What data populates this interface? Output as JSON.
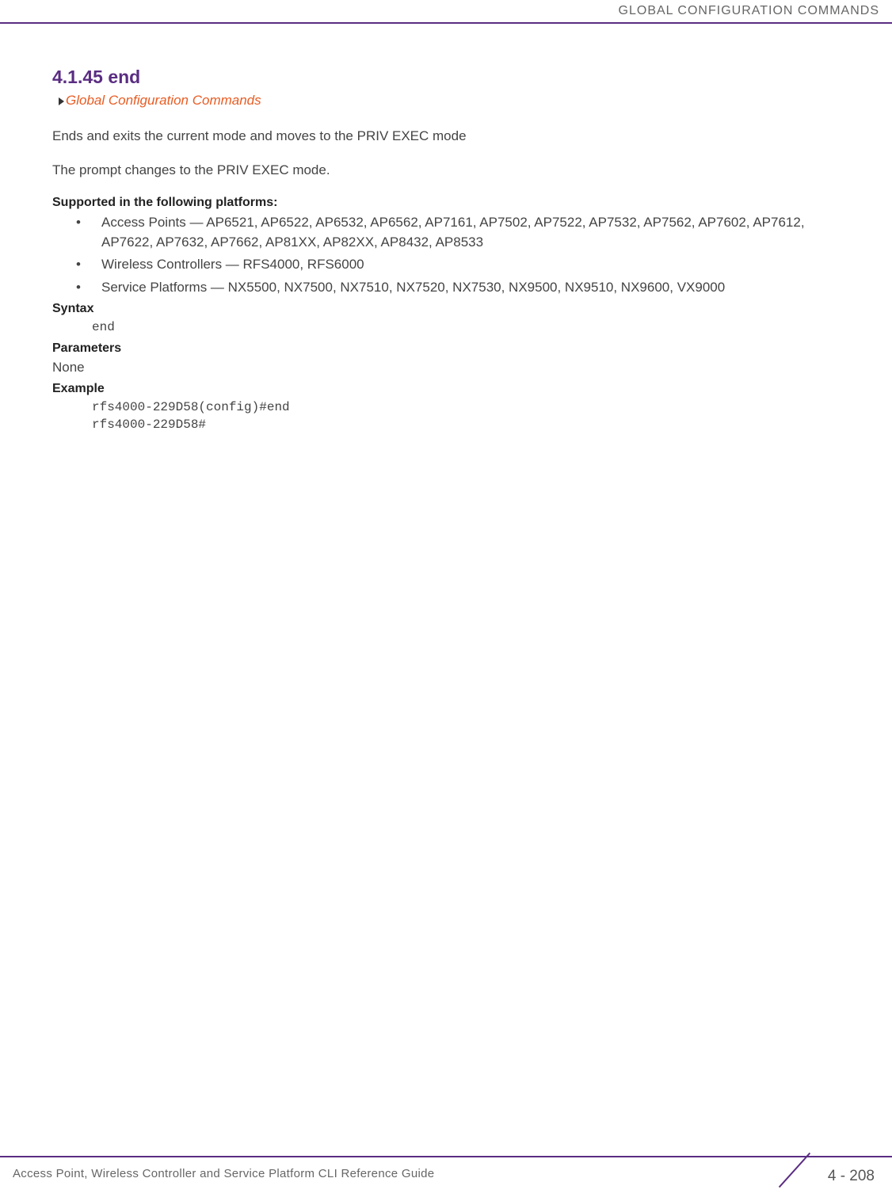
{
  "header": {
    "running_title": "GLOBAL CONFIGURATION COMMANDS"
  },
  "section": {
    "number_title": "4.1.45 end",
    "breadcrumb": "Global Configuration Commands",
    "desc1": "Ends and exits the current mode and moves to the PRIV EXEC mode",
    "desc2": "The prompt changes to the PRIV EXEC mode.",
    "supported_heading": "Supported in the following platforms:",
    "platforms": [
      "Access Points — AP6521, AP6522, AP6532, AP6562, AP7161, AP7502, AP7522, AP7532, AP7562, AP7602, AP7612, AP7622, AP7632, AP7662, AP81XX, AP82XX, AP8432, AP8533",
      "Wireless Controllers — RFS4000, RFS6000",
      "Service Platforms — NX5500, NX7500, NX7510, NX7520, NX7530, NX9500, NX9510, NX9600, VX9000"
    ],
    "syntax_heading": "Syntax",
    "syntax_code": "end",
    "parameters_heading": "Parameters",
    "parameters_value": "None",
    "example_heading": "Example",
    "example_code": "rfs4000-229D58(config)#end\nrfs4000-229D58#"
  },
  "footer": {
    "guide_title": "Access Point, Wireless Controller and Service Platform CLI Reference Guide",
    "page": "4 - 208"
  }
}
